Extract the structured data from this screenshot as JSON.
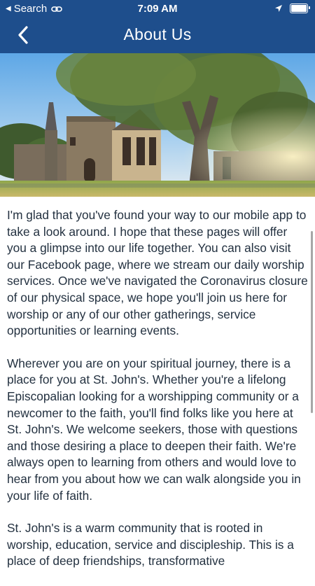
{
  "status_bar": {
    "back_app": "Search",
    "time": "7:09 AM"
  },
  "nav": {
    "title": "About Us",
    "back_icon": "chevron-left-icon"
  },
  "hero": {
    "description_icon": "church-photo"
  },
  "content": {
    "paragraphs": [
      "I'm glad that you've found your way to our mobile app to take a look around. I hope that these pages will offer you a glimpse into our life together. You can also visit our Facebook page, where we stream our daily worship services. Once we've navigated the Coronavirus closure of our physical space, we hope you'll join us here for worship or any of our other gatherings, service opportunities or learning events.",
      "Wherever you are on your spiritual journey, there is a place for you at St. John's. Whether you're a lifelong Episcopalian looking for a worshipping community or a newcomer to the faith, you'll find folks like you here at St. John's. We welcome seekers, those with questions and those desiring a place to deepen their faith. We're always open to learning from others and would love to hear from you about how we can walk alongside you in your life of faith.",
      "St. John's is a warm community that is rooted in worship, education, service and discipleship. This is a place of deep friendships, transformative"
    ]
  },
  "colors": {
    "header": "#1e4e8c",
    "text": "#233140"
  }
}
